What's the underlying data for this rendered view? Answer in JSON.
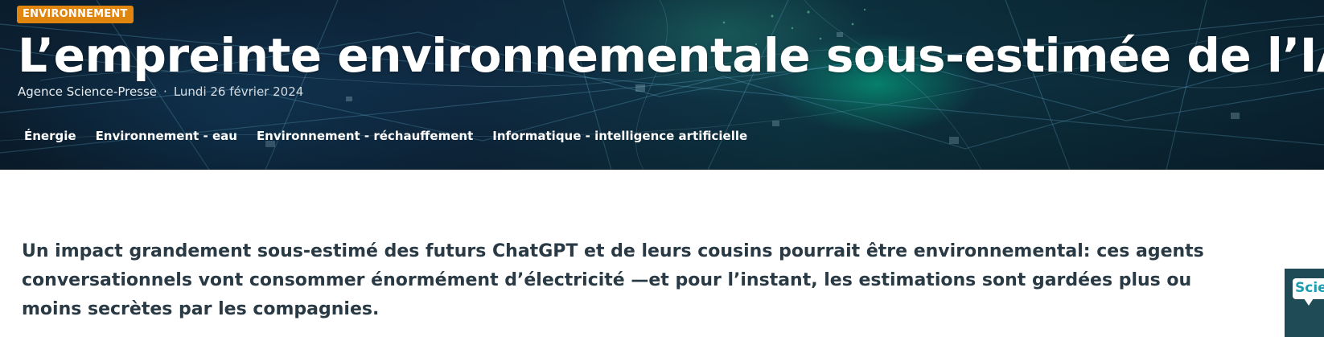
{
  "header": {
    "category": "ENVIRONNEMENT",
    "title": "L’empreinte environnementale sous-estimée de l’IA",
    "author": "Agence Science-Presse",
    "separator": "·",
    "date": "Lundi 26 février 2024",
    "tags": [
      {
        "label": "Énergie"
      },
      {
        "label": "Environnement - eau"
      },
      {
        "label": "Environnement - réchauffement"
      },
      {
        "label": "Informatique - intelligence artificielle"
      }
    ]
  },
  "article": {
    "lead": "Un impact grandement sous-estimé des futurs ChatGPT et de leurs cousins pourrait être environnemental: ces agents conversationnels vont consommer énormément d’électricité —et pour l’instant, les estimations sont gardées plus ou moins secrètes par les compagnies."
  },
  "side_widget": {
    "label": "Scie"
  },
  "colors": {
    "badge": "#e0860f",
    "hero_dark": "#0c2235",
    "hero_glow": "#00c896",
    "lead_text": "#2a3a45",
    "widget_bg": "#1e4b55",
    "widget_text": "#1a9fb0"
  }
}
